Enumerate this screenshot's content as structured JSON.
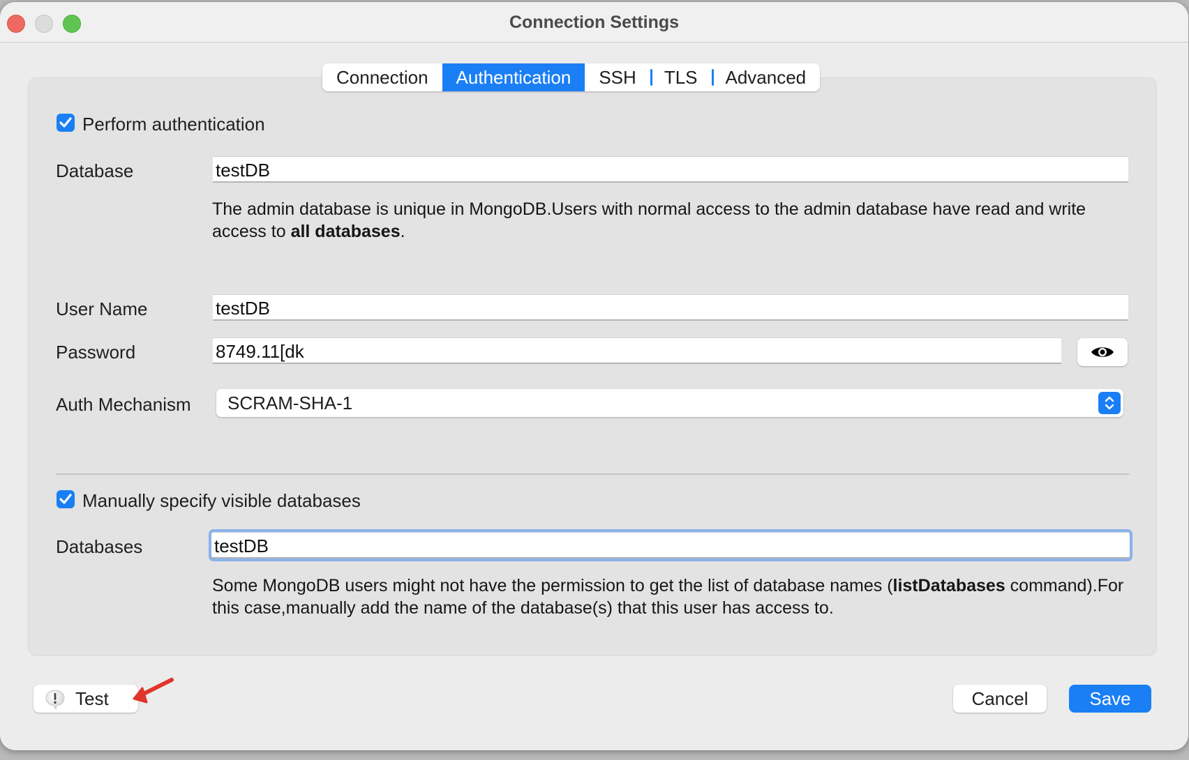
{
  "window": {
    "title": "Connection Settings"
  },
  "tabs": [
    {
      "label": "Connection",
      "active": false
    },
    {
      "label": "Authentication",
      "active": true
    },
    {
      "label": "SSH",
      "active": false
    },
    {
      "label": "TLS",
      "active": false
    },
    {
      "label": "Advanced",
      "active": false
    }
  ],
  "auth": {
    "perform_auth_label": "Perform authentication",
    "perform_auth_checked": true,
    "database_label": "Database",
    "database_value": "testDB",
    "database_help_1": "The admin database is unique in MongoDB.Users with normal access to the admin database have read and write access to ",
    "database_help_bold": "all databases",
    "database_help_2": ".",
    "username_label": "User Name",
    "username_value": "testDB",
    "password_label": "Password",
    "password_value": "8749.11[dk",
    "show_password_icon": "eye-icon",
    "mechanism_label": "Auth Mechanism",
    "mechanism_value": "SCRAM-SHA-1"
  },
  "visible_dbs": {
    "manual_label": "Manually specify visible databases",
    "manual_checked": true,
    "databases_label": "Databases",
    "databases_value": "testDB",
    "help_1": "Some MongoDB users might not have the permission to get the list of database names (",
    "help_bold": "listDatabases",
    "help_2": " command).For this case,manually add the name of the database(s) that this user has access to."
  },
  "footer": {
    "test_label": "Test",
    "test_icon": "alert-bubble-icon",
    "cancel_label": "Cancel",
    "save_label": "Save"
  },
  "colors": {
    "accent": "#1a7ff5",
    "annotation_arrow": "#e0352b"
  }
}
